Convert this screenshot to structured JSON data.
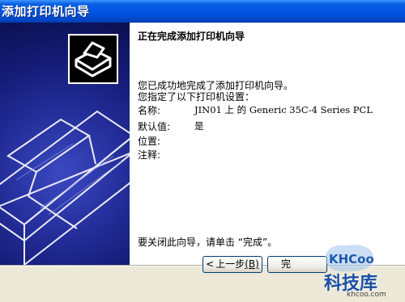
{
  "window": {
    "title": "添加打印机向导"
  },
  "wizard": {
    "heading": "正在完成添加打印机向导",
    "success_text": "您已成功地完成了添加打印机向导。",
    "settings_intro": "您指定了以下打印机设置：",
    "settings": [
      {
        "label": "名称:",
        "value": "JIN01 上 的 Generic 35C-4 Series PCL"
      },
      {
        "label": "默认值:",
        "value": "是"
      },
      {
        "label": "位置:",
        "value": ""
      },
      {
        "label": "注释:",
        "value": ""
      }
    ],
    "closing_text": "要关闭此向导，请单击 “完成”。"
  },
  "buttons": {
    "back_arrow": "<",
    "back_label": "上一步",
    "back_hotkey": "(B)",
    "finish_label": "完"
  },
  "watermark": {
    "badge": "KHCoo",
    "name": "科技库",
    "url": "khcoo.com"
  },
  "colors": {
    "titlebar": "#0054e3",
    "side_panel": "#1c2590",
    "dialog_face": "#ece9d8"
  },
  "icons": {
    "wizard_image": "printer-icon"
  }
}
